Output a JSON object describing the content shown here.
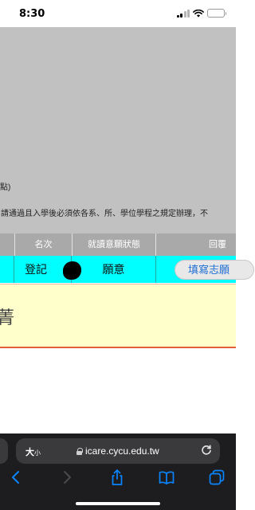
{
  "status_bar": {
    "time": "8:30",
    "icons": [
      "signal-icon",
      "wifi-icon",
      "battery-icon"
    ]
  },
  "page": {
    "note_point": "點)",
    "note_rule": "請通過且入學後必須依各系、所、學位學程之規定辦理，不"
  },
  "table": {
    "headers": [
      "名次",
      "就讀意願狀態",
      "回覆"
    ],
    "row": {
      "rank_text": "登記",
      "status": "願意",
      "reply_button": "填寫志願"
    }
  },
  "panel": {
    "text": "菁"
  },
  "browser": {
    "text_size_label": "大",
    "text_size_small": "小",
    "url": "icare.cycu.edu.tw",
    "toolbar_icons": [
      "back-icon",
      "forward-icon",
      "share-icon",
      "bookmarks-icon",
      "tabs-icon"
    ]
  },
  "colors": {
    "row_highlight": "#00ffff",
    "panel_background": "#ffffcc",
    "panel_border": "#e0603a",
    "link_blue": "#1f6ed4",
    "toolbar_blue": "#0a84ff"
  }
}
